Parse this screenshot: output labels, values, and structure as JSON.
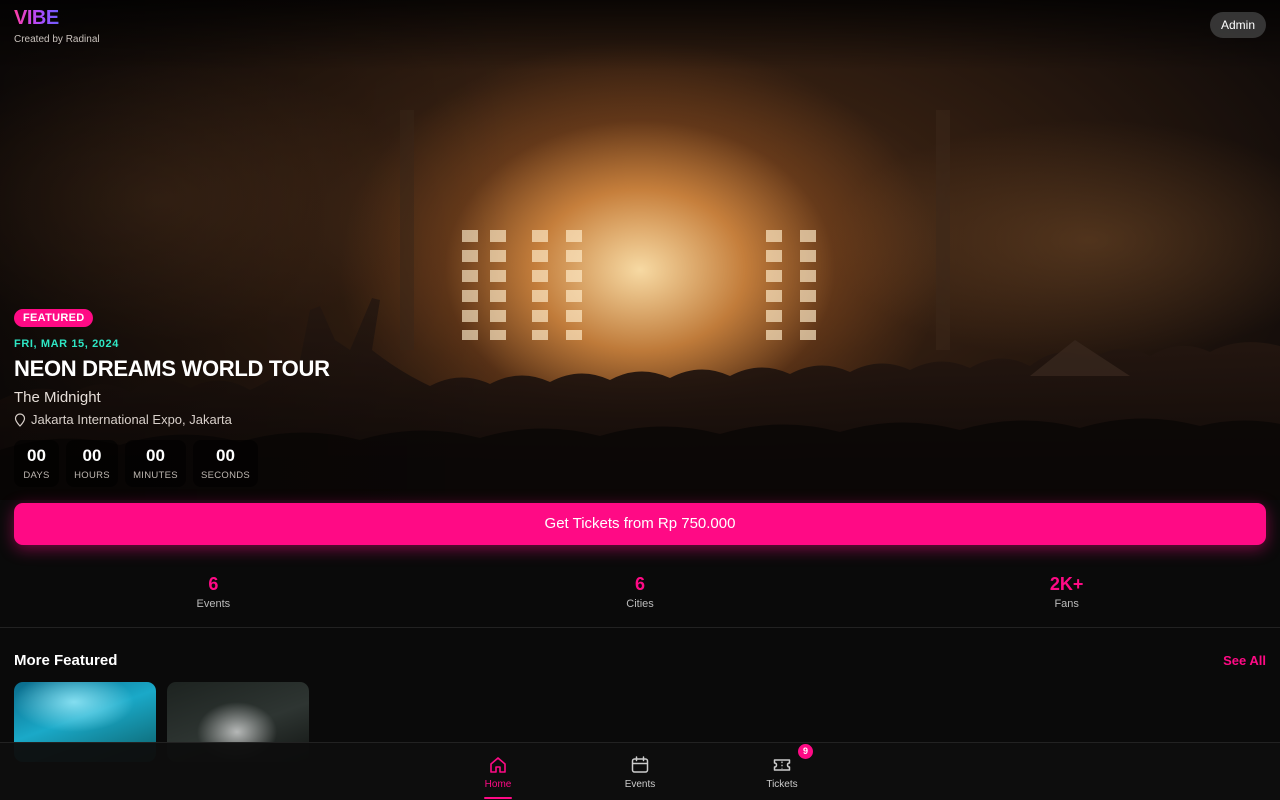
{
  "app": {
    "logo": "VIBE",
    "created_by": "Created by Radinal",
    "admin_label": "Admin"
  },
  "hero": {
    "badge": "FEATURED",
    "date": "FRI, MAR 15, 2024",
    "title": "NEON DREAMS WORLD TOUR",
    "artist": "The Midnight",
    "venue": "Jakarta International Expo, Jakarta",
    "countdown": [
      {
        "value": "00",
        "label": "DAYS"
      },
      {
        "value": "00",
        "label": "HOURS"
      },
      {
        "value": "00",
        "label": "MINUTES"
      },
      {
        "value": "00",
        "label": "SECONDS"
      }
    ],
    "cta_label": "Get Tickets from Rp 750.000"
  },
  "stats": [
    {
      "value": "6",
      "label": "Events"
    },
    {
      "value": "6",
      "label": "Cities"
    },
    {
      "value": "2K+",
      "label": "Fans"
    }
  ],
  "more_featured": {
    "title": "More Featured",
    "see_all": "See All"
  },
  "nav": {
    "items": [
      {
        "label": "Home",
        "icon": "home-icon",
        "active": true
      },
      {
        "label": "Events",
        "icon": "calendar-icon",
        "active": false
      },
      {
        "label": "Tickets",
        "icon": "ticket-icon",
        "active": false,
        "badge": "9"
      }
    ]
  },
  "colors": {
    "accent": "#ff0a85",
    "date": "#2ee6c4",
    "background": "#0a0a0a"
  }
}
